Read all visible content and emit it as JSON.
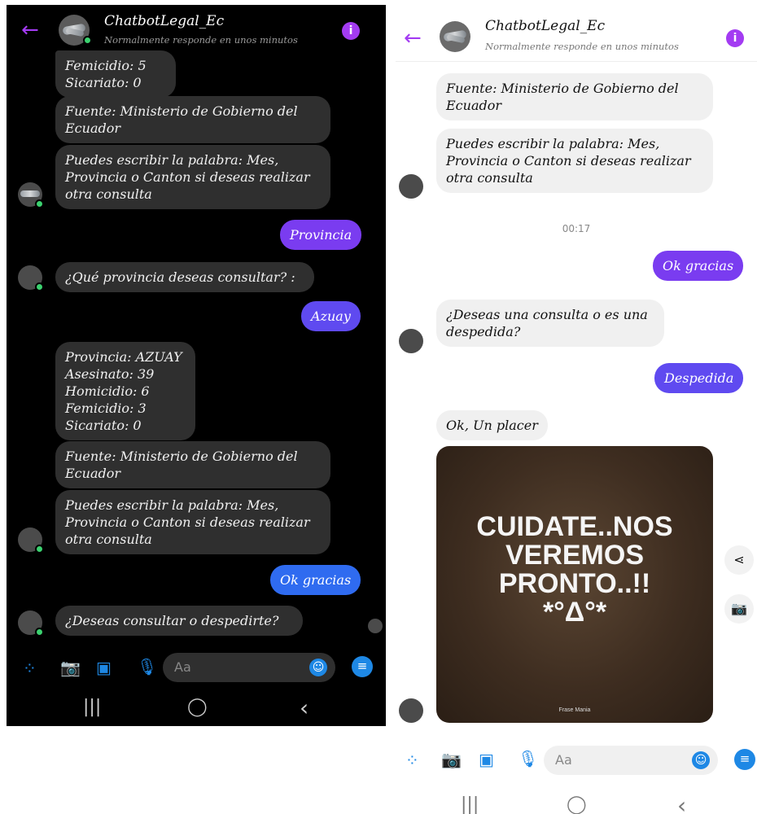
{
  "left": {
    "header": {
      "back": "←",
      "title": "ChatbotLegal_Ec",
      "subtitle": "Normalmente responde en unos minutos",
      "info": "i"
    },
    "msg_stats_top": "Femicidio: 5\nSicariato: 0",
    "msg_source1": "Fuente: Ministerio de Gobierno del\nEcuador",
    "msg_hint1": "Puedes escribir la palabra: Mes,\nProvincia o Canton si deseas realizar\notra consulta",
    "me_provincia": "Provincia",
    "msg_ask_province": "¿Qué provincia deseas consultar? :",
    "me_azuay": "Azuay",
    "msg_stats_azuay": "Provincia: AZUAY\nAsesinato: 39\nHomicidio: 6\nFemicidio: 3\nSicariato: 0",
    "msg_source2": "Fuente: Ministerio de Gobierno del\nEcuador",
    "msg_hint2": "Puedes escribir la palabra: Mes,\nProvincia o Canton si deseas realizar\notra consulta",
    "me_ok": "Ok gracias",
    "msg_ask_end": "¿Deseas consultar o despedirte?",
    "composer": {
      "placeholder": "Aa"
    },
    "nav": {
      "recent": "|||",
      "home": "◯",
      "back": "‹"
    }
  },
  "right": {
    "header": {
      "back": "←",
      "title": "ChatbotLegal_Ec",
      "subtitle": "Normalmente responde en unos minutos",
      "info": "i"
    },
    "msg_source": "Fuente: Ministerio de Gobierno del\nEcuador",
    "msg_hint": "Puedes escribir la palabra: Mes,\nProvincia o Canton si deseas realizar\notra consulta",
    "timestamp": "00:17",
    "me_ok": "Ok gracias",
    "msg_ask": "¿Deseas una consulta o es una\ndespedida?",
    "me_despedida": "Despedida",
    "msg_ok": "Ok, Un placer",
    "image_text": "CUIDATE..NOS\nVEREMOS\nPRONTO..!!\n*°Δ°*",
    "image_brand": "Frase Mania",
    "composer": {
      "placeholder": "Aa"
    },
    "nav": {
      "recent": "|||",
      "home": "◯",
      "back": "‹"
    }
  },
  "colors": {
    "accent_purple": "#a33bf2",
    "bubble_purple": "#7a3cf0",
    "bubble_blue": "#2f6bf0",
    "messenger_blue": "#1e88e5"
  }
}
